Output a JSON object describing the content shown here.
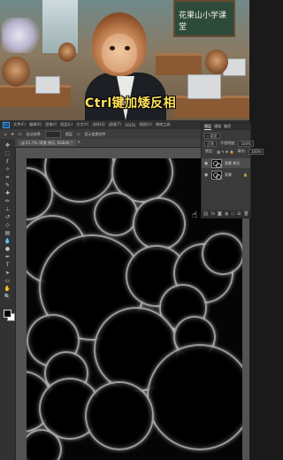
{
  "video": {
    "caption": "Ctrl键加矮反相",
    "board_text": "花果山小学课堂"
  },
  "photoshop": {
    "menu": [
      "文件(F)",
      "编辑(E)",
      "图像(I)",
      "图层(L)",
      "文字(Y)",
      "选择(S)",
      "滤镜(T)",
      "3D(D)",
      "视图(V)",
      "增效工具"
    ],
    "options": [
      "自动选择:",
      "图层",
      "显示变换控件"
    ],
    "document_tab": "@ 61.7% (背景 拷贝, RGB/8) *",
    "tools": [
      "move-icon",
      "marquee-icon",
      "lasso-icon",
      "magic-wand-icon",
      "crop-icon",
      "eyedropper-icon",
      "healing-icon",
      "brush-icon",
      "stamp-icon",
      "history-brush-icon",
      "eraser-icon",
      "gradient-icon",
      "blur-icon",
      "dodge-icon",
      "pen-icon",
      "type-icon",
      "path-select-icon",
      "shape-icon",
      "hand-icon",
      "zoom-icon"
    ],
    "foreground_color": "#000000",
    "background_color": "#ffffff",
    "layers_panel": {
      "tabs": [
        "图层",
        "通道",
        "路径"
      ],
      "filter_label": "类型",
      "blend_mode": "正常",
      "opacity_label": "不透明度:",
      "opacity_value": "100%",
      "lock_label": "锁定:",
      "fill_label": "填充:",
      "fill_value": "100%",
      "layers": [
        {
          "name": "背景 拷贝",
          "selected": true
        },
        {
          "name": "背景",
          "selected": false,
          "locked": true
        }
      ]
    },
    "accent_color": "#31a8ff"
  }
}
